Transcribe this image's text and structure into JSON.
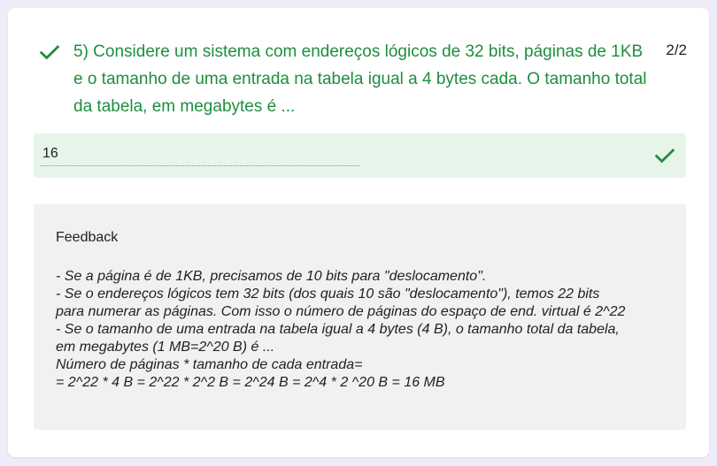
{
  "question": {
    "text": "5) Considere um sistema com endereços lógicos de 32 bits, páginas de 1KB e o tamanho de uma entrada na tabela igual a 4 bytes cada. O tamanho total da tabela, em megabytes é ...",
    "score": "2/2",
    "status_icon": "check-icon"
  },
  "answer": {
    "value": "16",
    "status_icon": "check-icon"
  },
  "feedback": {
    "title": "Feedback",
    "lines": [
      "- Se a página é de 1KB, precisamos de 10 bits para \"deslocamento\".",
      "- Se o endereços lógicos tem 32 bits (dos quais 10 são \"deslocamento\"), temos 22 bits",
      "para numerar as páginas. Com isso o número de páginas do espaço de end. virtual é 2^22",
      "- Se o tamanho de uma entrada na tabela igual a 4 bytes (4 B), o tamanho total da tabela,",
      "em megabytes (1 MB=2^20 B) é ...",
      "Número de páginas * tamanho de cada entrada=",
      "= 2^22 * 4 B = 2^22 * 2^2 B = 2^24 B = 2^4 * 2 ^20 B = 16 MB"
    ]
  },
  "colors": {
    "correct_green": "#1e8e3e",
    "answer_bg": "#e6f4ea",
    "feedback_bg": "#f1f1f1"
  }
}
